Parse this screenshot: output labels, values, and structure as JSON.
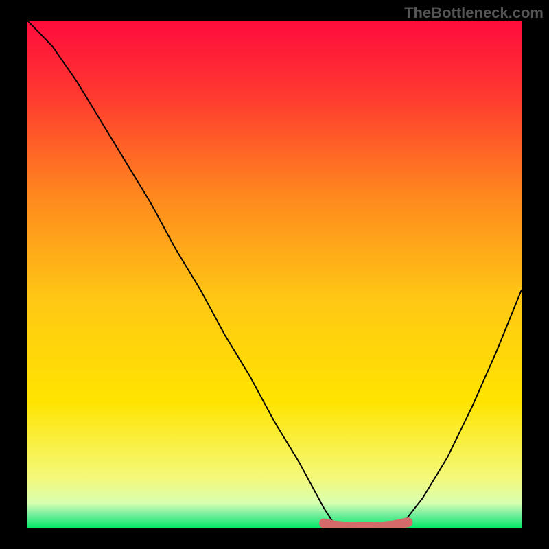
{
  "watermark": "TheBottleneck.com",
  "chart_data": {
    "type": "line",
    "title": "",
    "xlabel": "",
    "ylabel": "",
    "xlim": [
      0,
      100
    ],
    "ylim": [
      0,
      100
    ],
    "background_gradient": {
      "top_color": "#ff0b3d",
      "mid_color": "#ffe400",
      "bottom_band_color": "#00e668",
      "bottom_band_height_pct": 3
    },
    "series": [
      {
        "name": "bottleneck-curve",
        "color": "#000000",
        "x": [
          0,
          5,
          10,
          15,
          20,
          25,
          30,
          35,
          40,
          45,
          50,
          55,
          60,
          62,
          65,
          70,
          74,
          76,
          80,
          85,
          90,
          95,
          100
        ],
        "y": [
          100,
          95,
          88,
          80,
          72,
          64,
          55,
          47,
          38,
          30,
          21,
          13,
          4,
          1,
          0,
          0,
          0,
          1,
          6,
          14,
          24,
          35,
          47
        ]
      }
    ],
    "markers": {
      "name": "optimal-range",
      "color": "#d46a6a",
      "x": [
        60,
        62,
        64,
        66,
        68,
        70,
        72,
        74,
        77
      ],
      "y": [
        1.0,
        0.6,
        0.4,
        0.3,
        0.3,
        0.3,
        0.4,
        0.6,
        1.2
      ]
    }
  }
}
